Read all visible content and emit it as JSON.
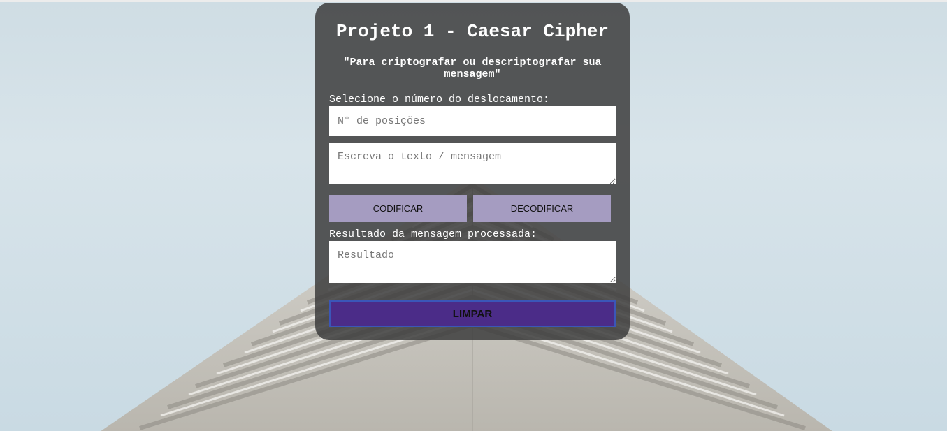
{
  "header": {
    "title": "Projeto 1 - Caesar Cipher",
    "subtitle": "\"Para criptografar ou descriptografar sua mensagem\""
  },
  "form": {
    "shift_label": "Selecione o número do deslocamento:",
    "shift_placeholder": "N° de posições",
    "message_placeholder": "Escreva o texto / mensagem",
    "encode_label": "CODIFICAR",
    "decode_label": "DECODIFICAR",
    "result_label": "Resultado da mensagem processada:",
    "result_placeholder": "Resultado",
    "clear_label": "LIMPAR"
  },
  "colors": {
    "card_bg": "#3e3e3e",
    "button_bg": "#a59cc1",
    "clear_bg": "#4b2c88",
    "clear_border": "#3b56b8"
  }
}
